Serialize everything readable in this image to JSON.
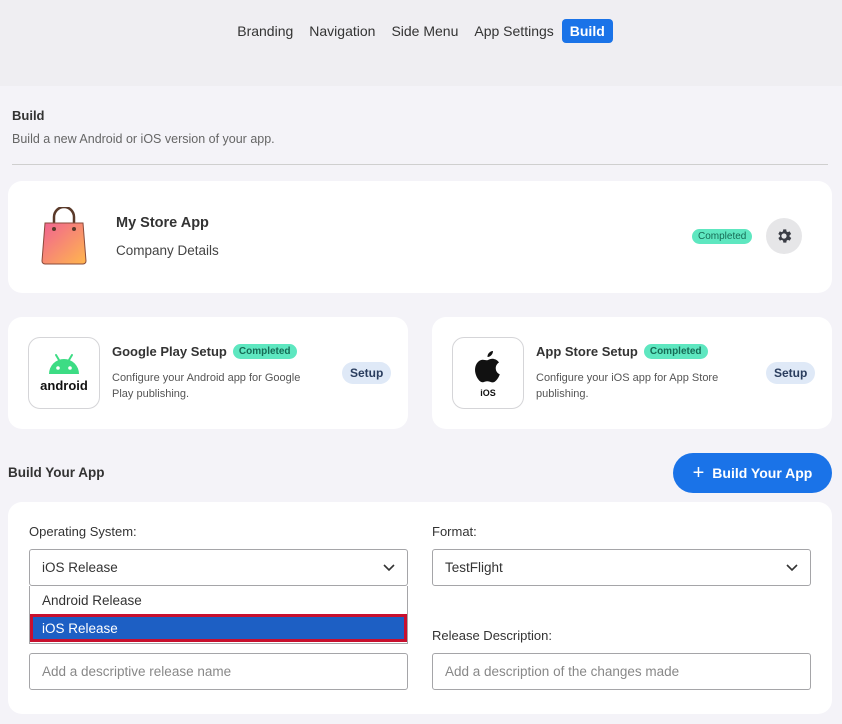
{
  "nav": {
    "tabs": [
      {
        "label": "Branding"
      },
      {
        "label": "Navigation"
      },
      {
        "label": "Side Menu"
      },
      {
        "label": "App Settings"
      },
      {
        "label": "Build",
        "active": true
      }
    ]
  },
  "page": {
    "title": "Build",
    "subtitle": "Build a new Android or iOS version of your app."
  },
  "app_card": {
    "name": "My Store App",
    "company": "Company Details",
    "status": "Completed",
    "settings_icon": "gear-icon"
  },
  "google_play": {
    "title": "Google Play Setup",
    "status": "Completed",
    "description": "Configure your Android app for Google Play publishing.",
    "setup_label": "Setup",
    "logo_text": "android"
  },
  "app_store": {
    "title": "App Store Setup",
    "status": "Completed",
    "description": "Configure your iOS app for App Store publishing.",
    "setup_label": "Setup",
    "logo_text": "iOS"
  },
  "build_section": {
    "title": "Build Your App",
    "button_label": "Build Your App"
  },
  "form": {
    "os_label": "Operating System:",
    "os_value": "iOS Release",
    "os_options": [
      "Android Release",
      "iOS Release"
    ],
    "format_label": "Format:",
    "format_value": "TestFlight",
    "release_desc_label": "Release Description:",
    "release_name_placeholder": "Add a descriptive release name",
    "release_desc_placeholder": "Add a description of the changes made"
  },
  "colors": {
    "accent": "#1a73e8",
    "badge": "#5ee7c0",
    "selected_option": "#1d5fc4",
    "highlight_border": "#c8102e"
  }
}
